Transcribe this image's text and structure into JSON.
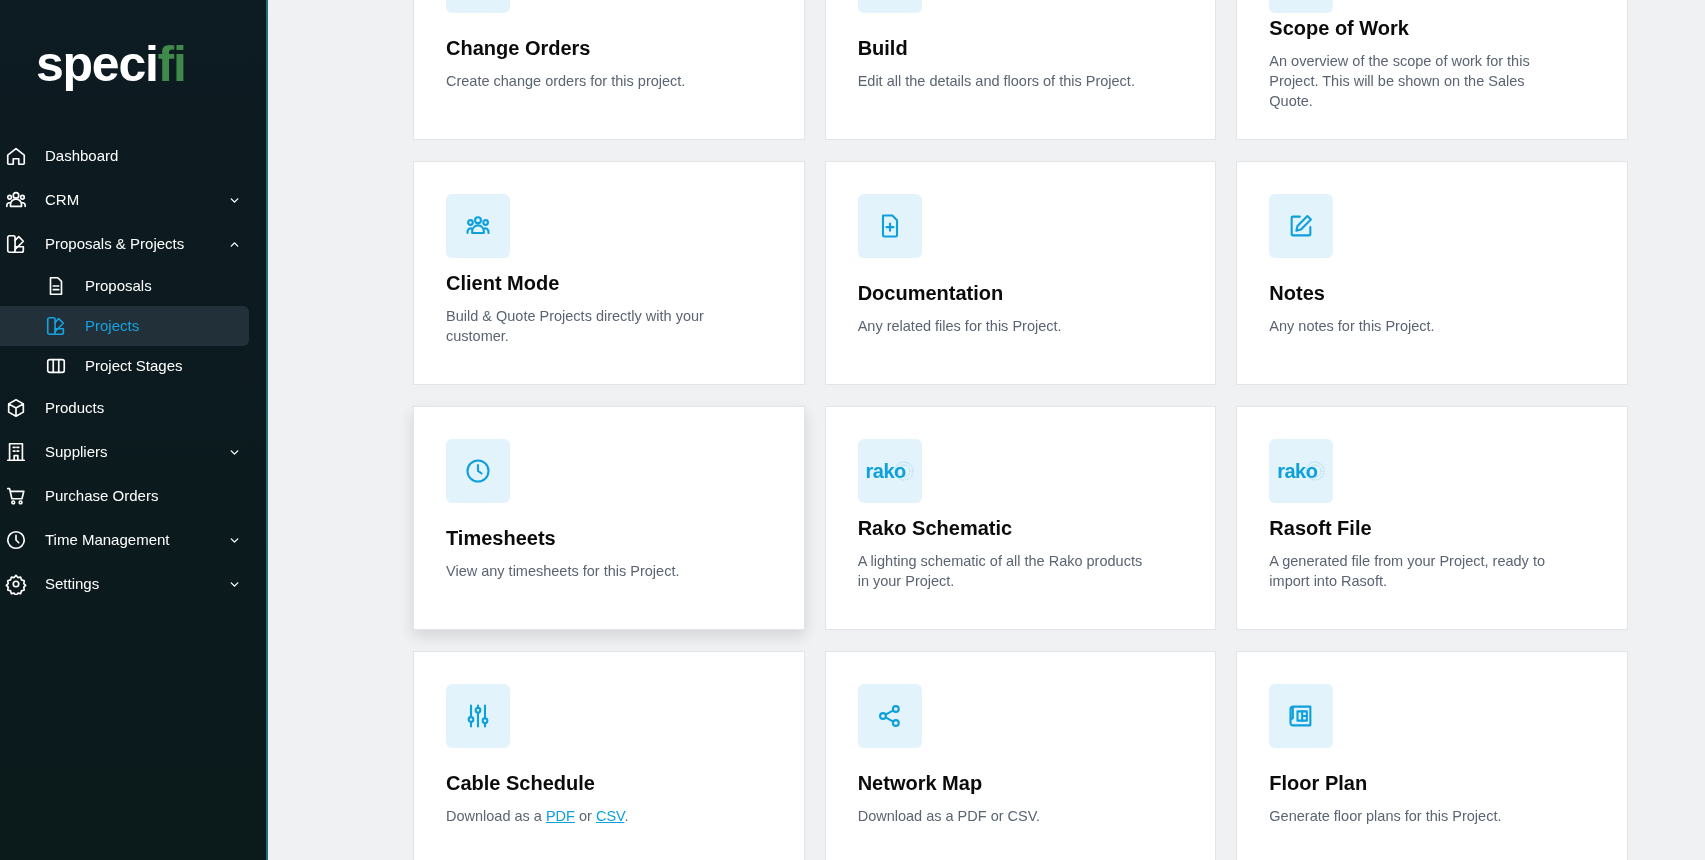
{
  "logo": {
    "main": "speci",
    "accent": "fi"
  },
  "sidebar": {
    "items": [
      {
        "label": "Dashboard",
        "selected": false
      },
      {
        "label": "CRM",
        "selected": false,
        "expanded": false
      },
      {
        "label": "Proposals & Projects",
        "selected": false,
        "expanded": true,
        "children": [
          {
            "label": "Proposals",
            "selected": false
          },
          {
            "label": "Projects",
            "selected": true
          },
          {
            "label": "Project Stages",
            "selected": false
          }
        ]
      },
      {
        "label": "Products",
        "selected": false
      },
      {
        "label": "Suppliers",
        "selected": false,
        "expanded": false
      },
      {
        "label": "Purchase Orders",
        "selected": false
      },
      {
        "label": "Time Management",
        "selected": false,
        "expanded": false
      },
      {
        "label": "Settings",
        "selected": false,
        "expanded": false
      }
    ]
  },
  "cards": [
    {
      "kind": "icon",
      "title": "Change Orders",
      "description": [
        {
          "text": "Create change orders for this project."
        }
      ],
      "hovered": false
    },
    {
      "kind": "icon",
      "title": "Build",
      "description": [
        {
          "text": "Edit all the details and floors of this Project."
        }
      ],
      "hovered": false
    },
    {
      "kind": "icon",
      "title": "Scope of Work",
      "description": [
        {
          "text": "An overview of the scope of work for this Project. This will be shown on the Sales Quote."
        }
      ],
      "hovered": false
    },
    {
      "kind": "icon",
      "title": "Client Mode",
      "description": [
        {
          "text": "Build & Quote Projects directly with your customer."
        }
      ],
      "hovered": false
    },
    {
      "kind": "icon",
      "title": "Documentation",
      "description": [
        {
          "text": "Any related files for this Project."
        }
      ],
      "hovered": false
    },
    {
      "kind": "icon",
      "title": "Notes",
      "description": [
        {
          "text": "Any notes for this Project."
        }
      ],
      "hovered": false
    },
    {
      "kind": "icon",
      "title": "Timesheets",
      "description": [
        {
          "text": "View any timesheets for this Project."
        }
      ],
      "hovered": true
    },
    {
      "kind": "logo",
      "logo_text": "rako",
      "title": "Rako Schematic",
      "description": [
        {
          "text": "A lighting schematic of all the Rako products in your Project."
        }
      ],
      "hovered": false
    },
    {
      "kind": "logo",
      "logo_text": "rako",
      "title": "Rasoft File",
      "description": [
        {
          "text": "A generated file from your Project, ready to import into Rasoft."
        }
      ],
      "hovered": false
    },
    {
      "kind": "icon",
      "title": "Cable Schedule",
      "description": [
        {
          "text": "Download as a "
        },
        {
          "text": "PDF",
          "kind": "link"
        },
        {
          "text": " or "
        },
        {
          "text": "CSV",
          "kind": "link"
        },
        {
          "text": "."
        }
      ],
      "hovered": false
    },
    {
      "kind": "icon",
      "title": "Network Map",
      "description": [
        {
          "text": "Download as a PDF or CSV."
        }
      ],
      "hovered": false
    },
    {
      "kind": "icon",
      "title": "Floor Plan",
      "description": [
        {
          "text": "Generate floor plans for this Project."
        }
      ],
      "hovered": false
    }
  ]
}
